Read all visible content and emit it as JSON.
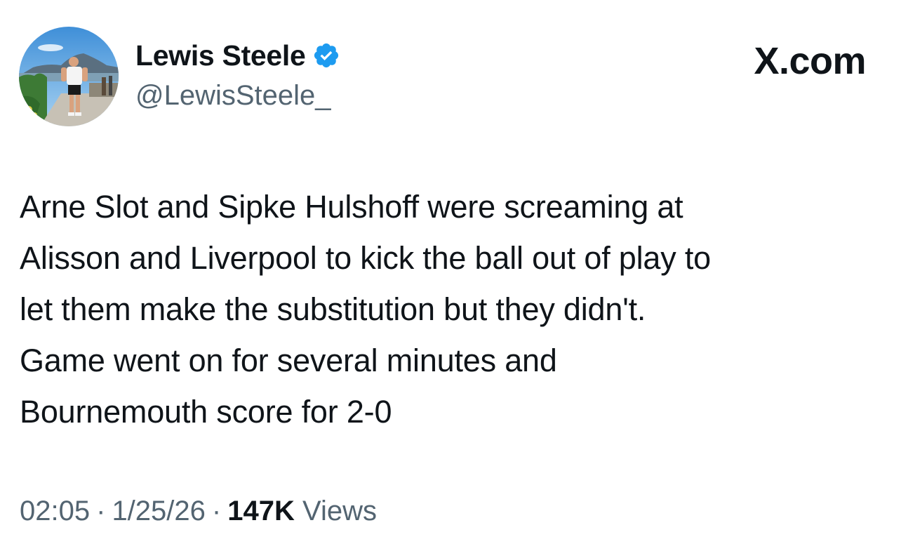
{
  "author": {
    "display_name": "Lewis Steele",
    "handle": "@LewisSteele_",
    "verified": true,
    "verified_color": "#1d9bf0"
  },
  "brand": {
    "label": "X.com"
  },
  "tweet": {
    "lines": [
      "Arne Slot and Sipke Hulshoff were screaming at",
      "Alisson and Liverpool to kick the ball out of play to",
      "let them make the substitution but they didn't.",
      "Game went on for several minutes and",
      "Bournemouth score for 2-0"
    ]
  },
  "meta": {
    "time": "02:05",
    "separator": "·",
    "date": "1/25/26",
    "views_count": "147K",
    "views_label": "Views"
  },
  "icons": {
    "verified": "verified-badge-icon"
  },
  "colors": {
    "text_primary": "#0f1419",
    "text_secondary": "#536471",
    "background": "#ffffff"
  }
}
